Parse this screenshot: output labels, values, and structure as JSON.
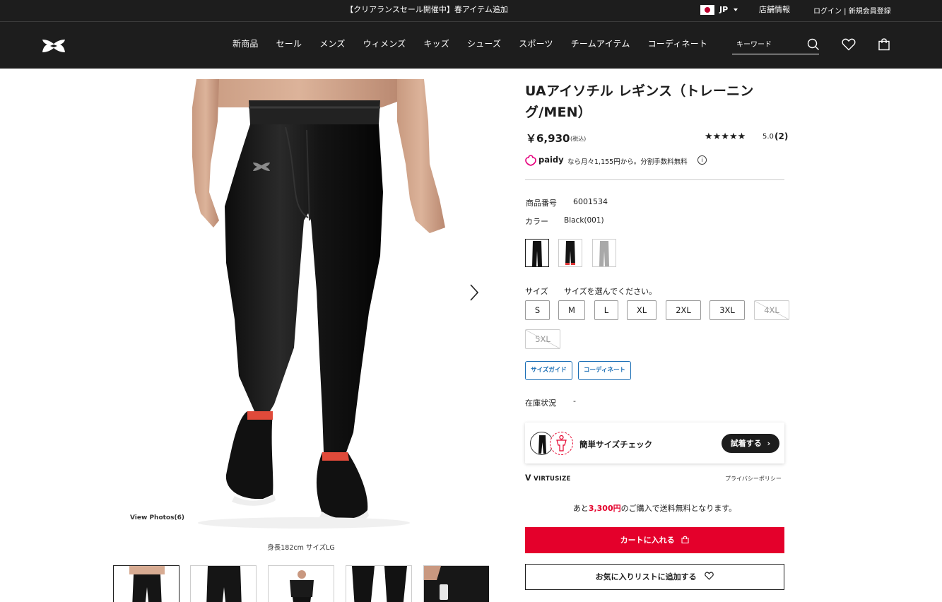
{
  "topbar": {
    "promo": "【クリアランスセール開催中】春アイテム追加",
    "country": "JP",
    "store_link": "店舗情報",
    "login_link": "ログイン | 新規会員登録"
  },
  "header": {
    "nav": [
      "新商品",
      "セール",
      "メンズ",
      "ウィメンズ",
      "キッズ",
      "シューズ",
      "スポーツ",
      "チームアイテム",
      "コーディネート"
    ],
    "search_placeholder": "キーワード"
  },
  "gallery": {
    "view_photos": "View Photos(6)",
    "caption": "身長182cm サイズLG"
  },
  "product": {
    "title": "UAアイソチル レギンス（トレーニング/MEN）",
    "price": "￥6,930",
    "tax": "(税込)",
    "stars": "★★★★★",
    "rating": "5.0",
    "reviews": "(2)",
    "paidy_brand": "paidy",
    "paidy_desc": "なら月々1,155円から。分割手数料無料",
    "info_icon": "i",
    "sku_label": "商品番号",
    "sku": "6001534",
    "color_label": "カラー",
    "color": "Black(001)",
    "size_label": "サイズ",
    "size_prompt": "サイズを選んでください。",
    "sizes": [
      {
        "label": "S",
        "available": true
      },
      {
        "label": "M",
        "available": true
      },
      {
        "label": "L",
        "available": true
      },
      {
        "label": "XL",
        "available": true
      },
      {
        "label": "2XL",
        "available": true
      },
      {
        "label": "3XL",
        "available": true
      },
      {
        "label": "4XL",
        "available": false
      },
      {
        "label": "5XL",
        "available": false
      }
    ],
    "size_guide": "サイズガイド",
    "coordinate": "コーディネート",
    "stock_label": "在庫状況",
    "stock_value": "-"
  },
  "virtusize": {
    "check_text": "簡単サイズチェック",
    "try_button": "試着する",
    "logo": "VIRTUSIZE",
    "privacy": "プライバシーポリシー"
  },
  "shipping": {
    "prefix": "あと",
    "amount": "3,300円",
    "suffix": "のご購入で送料無料となります。"
  },
  "actions": {
    "cart": "カートに入れる",
    "wishlist": "お気に入りリストに追加する"
  },
  "colors": {
    "brand_red": "#e4002b",
    "header_bg": "#1d1d1d",
    "link_blue": "#1a6eb5"
  }
}
